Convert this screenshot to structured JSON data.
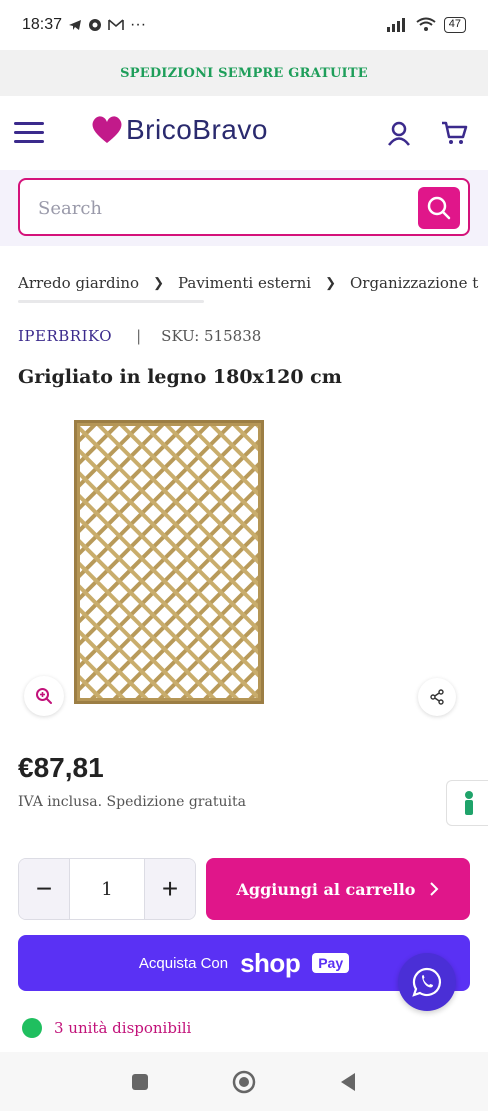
{
  "status_bar": {
    "time": "18:37",
    "icons_left": [
      "telegram-icon",
      "location-icon",
      "gmail-icon",
      "more-dots-icon"
    ],
    "more": "···",
    "battery": "47"
  },
  "promo": {
    "text": "SPEDIZIONI SEMPRE GRATUITE",
    "color": "#1e9e5a"
  },
  "header": {
    "logo_text": "BricoBravo"
  },
  "search": {
    "placeholder": "Search"
  },
  "breadcrumb": [
    "Arredo giardino",
    "Pavimenti esterni",
    "Organizzazione t"
  ],
  "breadcrumb_sep": "❯",
  "product": {
    "brand": "IPERBRIKO",
    "meta_sep": "|",
    "sku": "SKU: 515838",
    "title": "Grigliato in legno 180x120 cm",
    "price": "€87,81",
    "price_note": "IVA inclusa. Spedizione gratuita"
  },
  "quantity": {
    "minus": "−",
    "value": "1",
    "plus": "+"
  },
  "buttons": {
    "add_to_cart": "Aggiungi al carrello",
    "shoppay_prefix": "Acquista Con",
    "shop_word": "shop",
    "pay_badge": "Pay"
  },
  "availability": "3 unità disponibili",
  "colors": {
    "accent": "#e0168a",
    "brand": "#3b2a8c",
    "shoppay": "#5a31f4"
  }
}
